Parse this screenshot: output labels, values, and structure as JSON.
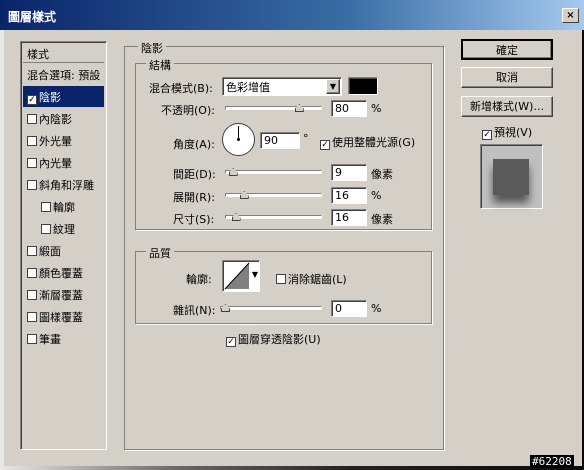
{
  "window": {
    "title": "圖層樣式",
    "close_glyph": "×"
  },
  "watermark": "#62208",
  "left_panel": {
    "header": "樣式",
    "items": [
      {
        "label": "混合選項: 預設",
        "checkbox": false,
        "checked": false,
        "selected": false,
        "indent": false
      },
      {
        "label": "陰影",
        "checkbox": true,
        "checked": true,
        "selected": true,
        "indent": false
      },
      {
        "label": "內陰影",
        "checkbox": true,
        "checked": false,
        "selected": false,
        "indent": false
      },
      {
        "label": "外光暈",
        "checkbox": true,
        "checked": false,
        "selected": false,
        "indent": false
      },
      {
        "label": "內光暈",
        "checkbox": true,
        "checked": false,
        "selected": false,
        "indent": false
      },
      {
        "label": "斜角和浮雕",
        "checkbox": true,
        "checked": false,
        "selected": false,
        "indent": false
      },
      {
        "label": "輪廓",
        "checkbox": true,
        "checked": false,
        "selected": false,
        "indent": true
      },
      {
        "label": "紋理",
        "checkbox": true,
        "checked": false,
        "selected": false,
        "indent": true
      },
      {
        "label": "緞面",
        "checkbox": true,
        "checked": false,
        "selected": false,
        "indent": false
      },
      {
        "label": "顏色覆蓋",
        "checkbox": true,
        "checked": false,
        "selected": false,
        "indent": false
      },
      {
        "label": "漸層覆蓋",
        "checkbox": true,
        "checked": false,
        "selected": false,
        "indent": false
      },
      {
        "label": "圖樣覆蓋",
        "checkbox": true,
        "checked": false,
        "selected": false,
        "indent": false
      },
      {
        "label": "筆畫",
        "checkbox": true,
        "checked": false,
        "selected": false,
        "indent": false
      }
    ]
  },
  "shadow": {
    "group_title": "陰影",
    "structure": {
      "title": "結構",
      "blend_mode_label": "混合模式(B):",
      "blend_mode_value": "色彩增值",
      "blend_color": "#000000",
      "opacity_label": "不透明(O):",
      "opacity_value": "80",
      "opacity_unit": "%",
      "opacity_level": 0.8,
      "angle_label": "角度(A):",
      "angle_value": "90",
      "angle_unit": "°",
      "use_global_light_label": "使用整體光源(G)",
      "use_global_light_checked": true,
      "distance_label": "間距(D):",
      "distance_value": "9",
      "distance_unit": "像素",
      "distance_level": 0.03,
      "spread_label": "展開(R):",
      "spread_value": "16",
      "spread_unit": "%",
      "spread_level": 0.16,
      "size_label": "尺寸(S):",
      "size_value": "16",
      "size_unit": "像素",
      "size_level": 0.064
    },
    "quality": {
      "title": "品質",
      "contour_label": "輪廓:",
      "anti_alias_label": "消除鋸齒(L)",
      "anti_alias_checked": false,
      "noise_label": "雜訊(N):",
      "noise_value": "0",
      "noise_unit": "%",
      "noise_level": 0
    },
    "knockout_label": "圖層穿透陰影(U)",
    "knockout_checked": true
  },
  "buttons": {
    "ok": "確定",
    "cancel": "取消",
    "new_style": "新增樣式(W)..."
  },
  "preview": {
    "label": "預視(V)",
    "checked": true
  }
}
